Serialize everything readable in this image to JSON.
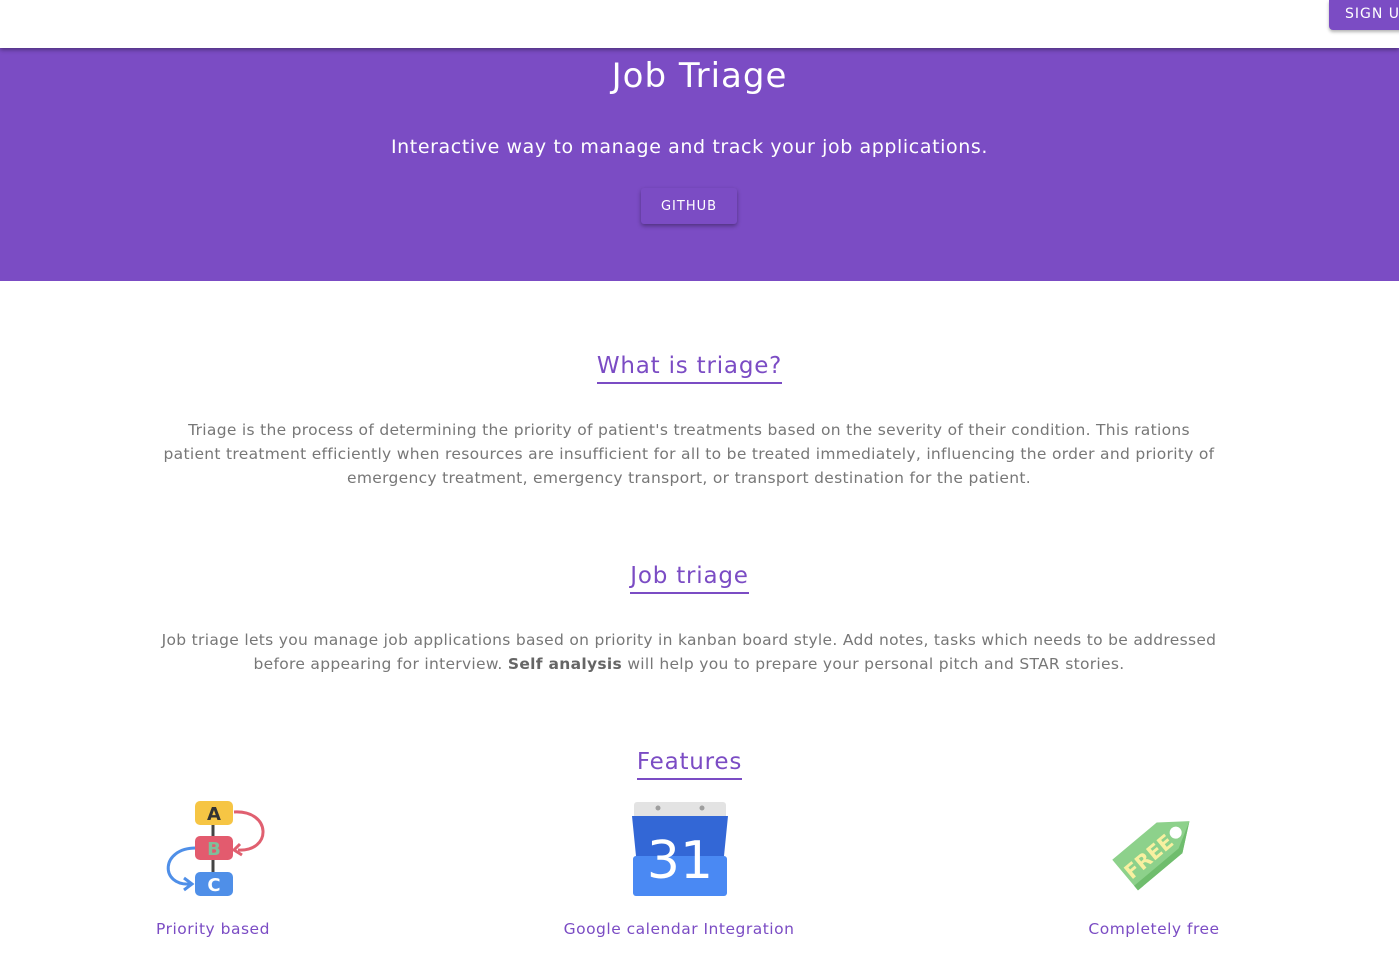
{
  "header": {
    "signup_label": "SIGN U"
  },
  "hero": {
    "title": "Job Triage",
    "subtitle": "Interactive way to manage and track your job applications.",
    "github_label": "GITHUB"
  },
  "what_is_triage": {
    "heading": "What is triage?",
    "text": "Triage is the process of determining the priority of patient's treatments based on the severity of their condition. This rations patient treatment efficiently when resources are insufficient for all to be treated immediately, influencing the order and priority of emergency treatment, emergency transport, or transport destination for the patient."
  },
  "job_triage": {
    "heading": "Job triage",
    "text_before": "Job triage lets you manage job applications based on priority in kanban board style. Add notes, tasks which needs to be addressed before appearing for interview.",
    "bold": "Self analysis",
    "text_after": "will help you to prepare your personal pitch and STAR stories."
  },
  "features": {
    "heading": "Features",
    "items": [
      {
        "label": "Priority based",
        "icon": "priority-abc-icon",
        "letters": [
          "A",
          "B",
          "C"
        ]
      },
      {
        "label": "Google calendar Integration",
        "icon": "google-calendar-icon",
        "day": "31"
      },
      {
        "label": "Completely free",
        "icon": "free-tag-icon",
        "tag_text": "FREE"
      }
    ]
  },
  "colors": {
    "brand": "#7b4cc4",
    "text": "#777777"
  }
}
